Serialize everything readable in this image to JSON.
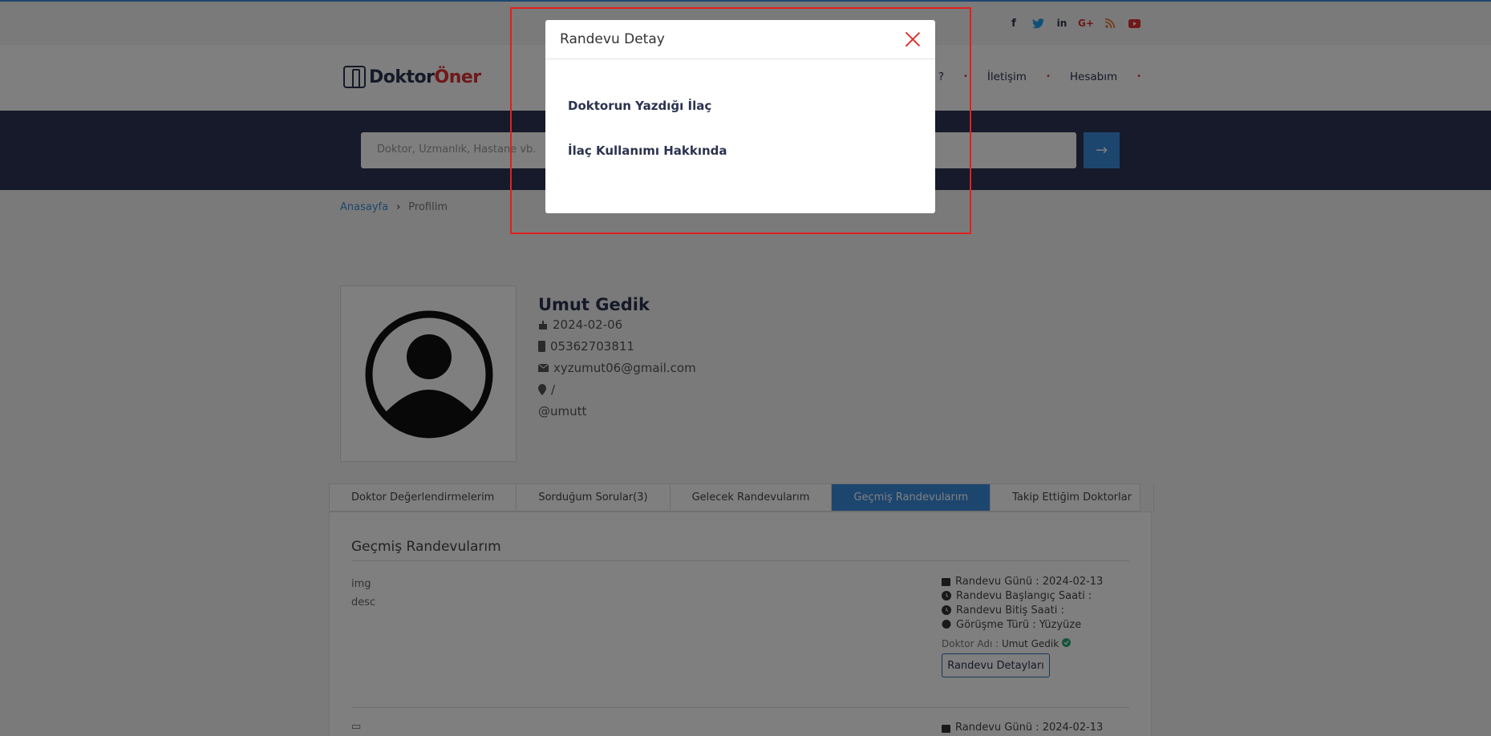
{
  "social": {
    "items": [
      "f",
      "t",
      "in",
      "G+",
      "rss",
      "yt"
    ],
    "colors": [
      "#2b3350",
      "#1da1f2",
      "#2b3350",
      "#e03030",
      "#e66b1e",
      "#e03030"
    ]
  },
  "logo": {
    "part1": "Doktor",
    "part2": "Öner"
  },
  "nav": {
    "item1": "usun ?",
    "item2": "İletişim",
    "item3": "Hesabım"
  },
  "search": {
    "placeholder": "Doktor, Uzmanlık, Hastane vb.",
    "arrow": "→"
  },
  "breadcrumb": {
    "home": "Anasayfa",
    "sep": "›",
    "current": "Profilim"
  },
  "profile": {
    "name": "Umut Gedik",
    "birth": "2024-02-06",
    "phone": "05362703811",
    "email": "xyzumut06@gmail.com",
    "location": "/",
    "username": "@umutt"
  },
  "tabs": [
    "Doktor Değerlendirmelerim",
    "Sorduğum Sorular(3)",
    "Gelecek Randevularım",
    "Geçmiş Randevularım",
    "Takip Ettiğim Doktorlar"
  ],
  "panel": {
    "title": "Geçmiş Randevularım",
    "img_alt": "img desc",
    "appointment": {
      "day": "Randevu Günü : 2024-02-13",
      "start": "Randevu Başlangıç Saati :",
      "end": "Randevu Bitiş Saati :",
      "type": "Görüşme Türü : Yüzyüze",
      "doctor_label": "Doktor Adı :",
      "doctor_name": "Umut Gedik",
      "button": "Randevu Detayları"
    },
    "appointment2": {
      "day": "Randevu Günü : 2024-02-13"
    }
  },
  "modal": {
    "title": "Randevu Detay",
    "item1": "Doktorun Yazdığı İlaç",
    "item2": "İlaç Kullanımı Hakkında"
  }
}
